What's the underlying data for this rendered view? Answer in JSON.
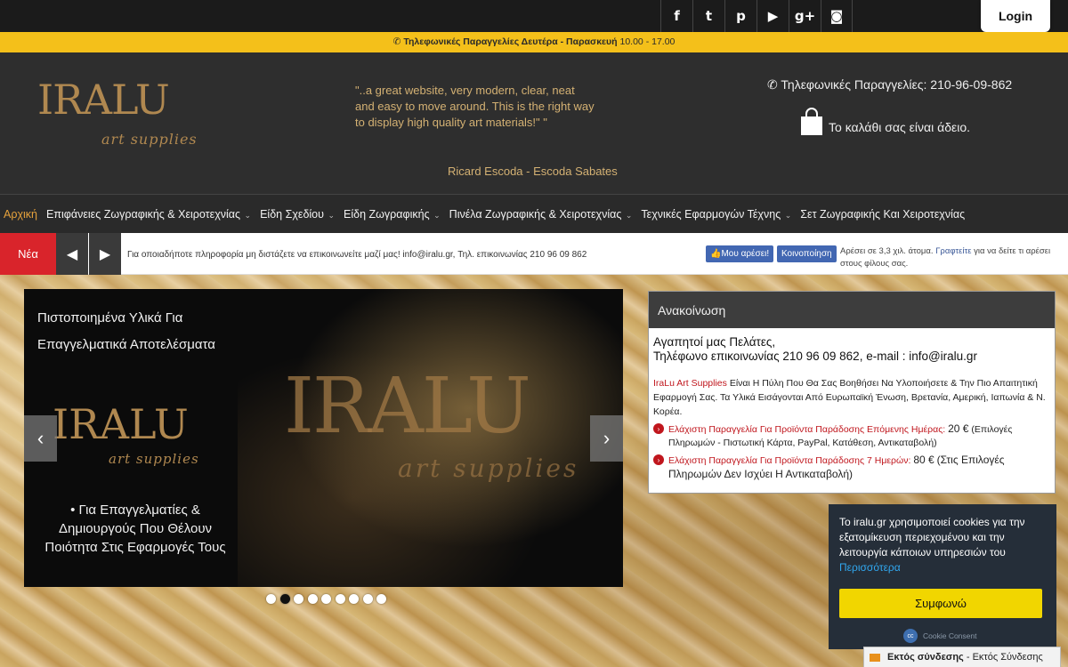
{
  "topbar": {
    "social": [
      {
        "icon": "facebook-icon",
        "glyph": "f"
      },
      {
        "icon": "twitter-icon",
        "glyph": "t"
      },
      {
        "icon": "pinterest-icon",
        "glyph": "p"
      },
      {
        "icon": "youtube-icon",
        "glyph": "▶"
      },
      {
        "icon": "google-plus-icon",
        "glyph": "g+"
      },
      {
        "icon": "instagram-icon",
        "glyph": "◙"
      }
    ],
    "login_label": "Login"
  },
  "yellowbar": {
    "bold_text": "Τηλεφωνικές Παραγγελίες Δευτέρα - Παρασκευή",
    "hours": "10.00 - 17.00"
  },
  "header": {
    "logo_main": "IRALU",
    "logo_sub": "art supplies",
    "quote": "\"..a great website, very modern, clear, neat and easy to move around. This is the right way to display high quality art materials!\" \"",
    "quote_author": "Ricard Escoda  - Escoda Sabates",
    "phone": "Τηλεφωνικές Παραγγελίες: 210-96-09-862",
    "cart_text": "Το καλάθι σας είναι άδειο."
  },
  "nav": {
    "items": [
      {
        "label": "Αρχική",
        "caret": false
      },
      {
        "label": "Επιφάνειες Ζωγραφικής & Χειροτεχνίας",
        "caret": true
      },
      {
        "label": "Είδη Σχεδίου",
        "caret": true
      },
      {
        "label": "Είδη Ζωγραφικής",
        "caret": true
      },
      {
        "label": "Πινέλα Ζωγραφικής & Χειροτεχνίας",
        "caret": true
      },
      {
        "label": "Τεχνικές Εφαρμογών Τέχνης",
        "caret": true
      },
      {
        "label": "Σετ Ζωγραφικής Και Χειροτεχνίας",
        "caret": false
      }
    ]
  },
  "ticker": {
    "label": "Νέα",
    "text": "Για οποιαδήποτε πληροφορία μη διστάζετε να επικοινωνείτε μαζί μας! info@iralu.gr, Τηλ. επικοινωνίας 210 96 09 862",
    "fb_like": "Μου αρέσει!",
    "fb_share": "Κοινοποίηση",
    "fb_text_before": "Αρέσει σε 3,3 χιλ. άτομα.",
    "fb_link": "Γραφτείτε",
    "fb_text_after": "για να δείτε τι αρέσει στους φίλους σας."
  },
  "slider": {
    "title": "Πιστοποιημένα Υλικά Για Επαγγελματικά Αποτελέσματα",
    "logo_main": "IRALU",
    "logo_sub": "art supplies",
    "bullet": "•  Για Επαγγελματίες  & Δημιουργούς Που Θέλουν Ποιότητα Στις Εφαρμογές Τους",
    "dots": 9,
    "active_dot": 1
  },
  "announcement": {
    "heading": "Ανακοίνωση",
    "greeting": "Αγαπητοί μας Πελάτες,",
    "contact": "Τηλέφωνο επικοινωνίας 210 96 09 862, e-mail : info@iralu.gr",
    "brand": "IraLu Art Supplies",
    "intro": "Είναι Η Πύλη Που Θα Σας Βοηθήσει Να Υλοποιήσετε & Την Πιο Απαιτητική Εφαρμογή Σας. Τα Υλικά Εισάγονται Από Ευρωπαϊκή Ένωση, Βρετανία, Αμερική, Ιαπωνία & Ν. Κορέα.",
    "item1_red": "Ελάχιστη Παραγγελία Για Προϊόντα Παράδοσης Επόμενης  Ημέρας:",
    "item1_value": "20 €",
    "item1_rest": "(Επιλογές Πληρωμών - Πιστωτική Κάρτα, PayPal, Κατάθεση, Αντικαταβολή)",
    "item2_red": "Ελάχιστη Παραγγελία Για Προϊόντα Παράδοσης 7 Ημερών:",
    "item2_value": "80 €",
    "item2_rest": "(Στις Επιλογές Πληρωμών Δεν Ισχύει Η  Αντικαταβολή)"
  },
  "cookie": {
    "text": "Το iralu.gr χρησιμοποιεί cookies για την εξατομίκευση περιεχομένου και την λειτουργία κάποιων υπηρεσιών του",
    "more": "Περισσότερα",
    "accept": "Συμφωνώ",
    "brand": "Cookie Consent"
  },
  "chat": {
    "status_bold": "Εκτός σύνδεσης",
    "status_rest": "- Εκτός Σύνδεσης"
  }
}
